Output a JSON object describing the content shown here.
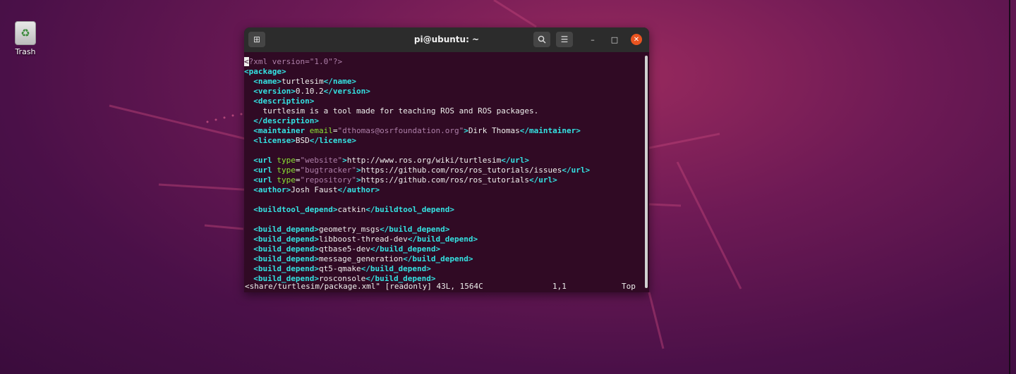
{
  "desktop": {
    "trash_label": "Trash",
    "trash_icon": "recycle-icon"
  },
  "window": {
    "title": "pi@ubuntu: ~",
    "new_tab_icon": "new-tab-icon",
    "search_icon": "search-icon",
    "menu_icon": "hamburger-menu-icon",
    "minimize_icon": "minimize-icon",
    "maximize_icon": "maximize-icon",
    "close_icon": "close-icon",
    "accent_close": "#e95420",
    "terminal_bg": "#300a24",
    "tag_color": "#34e2e2",
    "attr_color": "#8ae234",
    "value_color": "#ad7fa8"
  },
  "editor": {
    "lines": [
      [
        [
          "pi",
          "<"
        ],
        [
          "pi",
          "?xml version=\"1.0\"?>"
        ]
      ],
      [
        [
          "tag",
          "<package>"
        ]
      ],
      [
        [
          "txt",
          "  "
        ],
        [
          "tag",
          "<name>"
        ],
        [
          "txt",
          "turtlesim"
        ],
        [
          "tag",
          "</name>"
        ]
      ],
      [
        [
          "txt",
          "  "
        ],
        [
          "tag",
          "<version>"
        ],
        [
          "txt",
          "0.10.2"
        ],
        [
          "tag",
          "</version>"
        ]
      ],
      [
        [
          "txt",
          "  "
        ],
        [
          "tag",
          "<description>"
        ]
      ],
      [
        [
          "txt",
          "    turtlesim is a tool made for teaching ROS and ROS packages."
        ]
      ],
      [
        [
          "txt",
          "  "
        ],
        [
          "tag",
          "</description>"
        ]
      ],
      [
        [
          "txt",
          "  "
        ],
        [
          "tag",
          "<maintainer "
        ],
        [
          "attr",
          "email"
        ],
        [
          "txt",
          "="
        ],
        [
          "val",
          "\"dthomas@osrfoundation.org\""
        ],
        [
          "tag",
          ">"
        ],
        [
          "txt",
          "Dirk Thomas"
        ],
        [
          "tag",
          "</maintainer>"
        ]
      ],
      [
        [
          "txt",
          "  "
        ],
        [
          "tag",
          "<license>"
        ],
        [
          "txt",
          "BSD"
        ],
        [
          "tag",
          "</license>"
        ]
      ],
      [],
      [
        [
          "txt",
          "  "
        ],
        [
          "tag",
          "<url "
        ],
        [
          "attr",
          "type"
        ],
        [
          "txt",
          "="
        ],
        [
          "val",
          "\"website\""
        ],
        [
          "tag",
          ">"
        ],
        [
          "txt",
          "http://www.ros.org/wiki/turtlesim"
        ],
        [
          "tag",
          "</url>"
        ]
      ],
      [
        [
          "txt",
          "  "
        ],
        [
          "tag",
          "<url "
        ],
        [
          "attr",
          "type"
        ],
        [
          "txt",
          "="
        ],
        [
          "val",
          "\"bugtracker\""
        ],
        [
          "tag",
          ">"
        ],
        [
          "txt",
          "https://github.com/ros/ros_tutorials/issues"
        ],
        [
          "tag",
          "</url>"
        ]
      ],
      [
        [
          "txt",
          "  "
        ],
        [
          "tag",
          "<url "
        ],
        [
          "attr",
          "type"
        ],
        [
          "txt",
          "="
        ],
        [
          "val",
          "\"repository\""
        ],
        [
          "tag",
          ">"
        ],
        [
          "txt",
          "https://github.com/ros/ros_tutorials"
        ],
        [
          "tag",
          "</url>"
        ]
      ],
      [
        [
          "txt",
          "  "
        ],
        [
          "tag",
          "<author>"
        ],
        [
          "txt",
          "Josh Faust"
        ],
        [
          "tag",
          "</author>"
        ]
      ],
      [],
      [
        [
          "txt",
          "  "
        ],
        [
          "tag",
          "<buildtool_depend>"
        ],
        [
          "txt",
          "catkin"
        ],
        [
          "tag",
          "</buildtool_depend>"
        ]
      ],
      [],
      [
        [
          "txt",
          "  "
        ],
        [
          "tag",
          "<build_depend>"
        ],
        [
          "txt",
          "geometry_msgs"
        ],
        [
          "tag",
          "</build_depend>"
        ]
      ],
      [
        [
          "txt",
          "  "
        ],
        [
          "tag",
          "<build_depend>"
        ],
        [
          "txt",
          "libboost-thread-dev"
        ],
        [
          "tag",
          "</build_depend>"
        ]
      ],
      [
        [
          "txt",
          "  "
        ],
        [
          "tag",
          "<build_depend>"
        ],
        [
          "txt",
          "qtbase5-dev"
        ],
        [
          "tag",
          "</build_depend>"
        ]
      ],
      [
        [
          "txt",
          "  "
        ],
        [
          "tag",
          "<build_depend>"
        ],
        [
          "txt",
          "message_generation"
        ],
        [
          "tag",
          "</build_depend>"
        ]
      ],
      [
        [
          "txt",
          "  "
        ],
        [
          "tag",
          "<build_depend>"
        ],
        [
          "txt",
          "qt5-qmake"
        ],
        [
          "tag",
          "</build_depend>"
        ]
      ],
      [
        [
          "txt",
          "  "
        ],
        [
          "tag",
          "<build_depend>"
        ],
        [
          "txt",
          "rosconsole"
        ],
        [
          "tag",
          "</build_depend>"
        ]
      ]
    ],
    "status_file": "<share/turtlesim/package.xml\" [readonly] 43L, 1564C",
    "status_pos": "1,1",
    "status_scroll": "Top"
  }
}
